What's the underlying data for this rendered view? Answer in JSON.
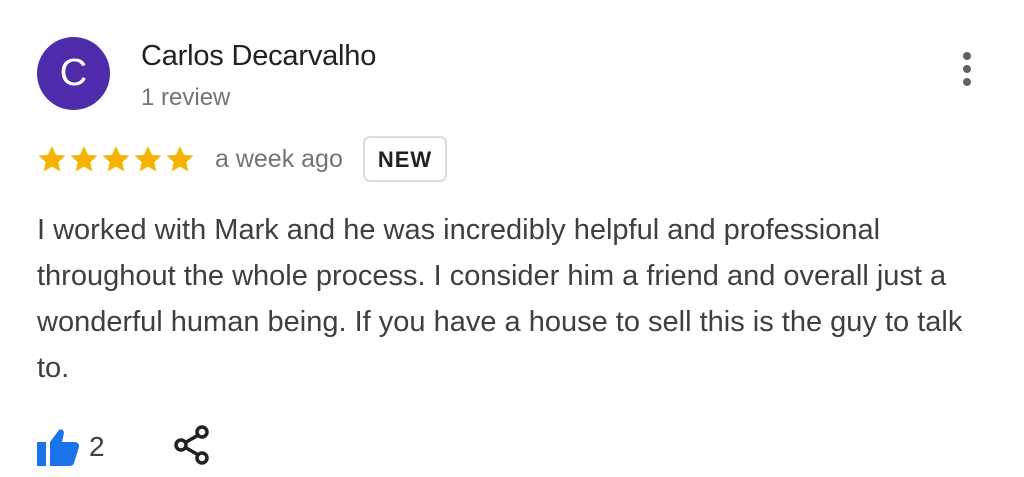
{
  "review": {
    "author": {
      "initial": "C",
      "name": "Carlos Decarvalho",
      "review_count": "1 review",
      "avatar_color": "#4e2bab"
    },
    "rating": 5,
    "star_color": "#f4b400",
    "time_ago": "a week ago",
    "badge": "NEW",
    "text": "I worked with Mark and he was incredibly helpful and professional throughout the whole process. I consider him a friend and overall just a wonderful human being. If you have a house to sell this is the guy to talk to.",
    "likes": "2",
    "like_color": "#1a73e8",
    "icons": {
      "more": "more-vert-icon",
      "like": "thumbs-up-icon",
      "share": "share-icon"
    }
  }
}
